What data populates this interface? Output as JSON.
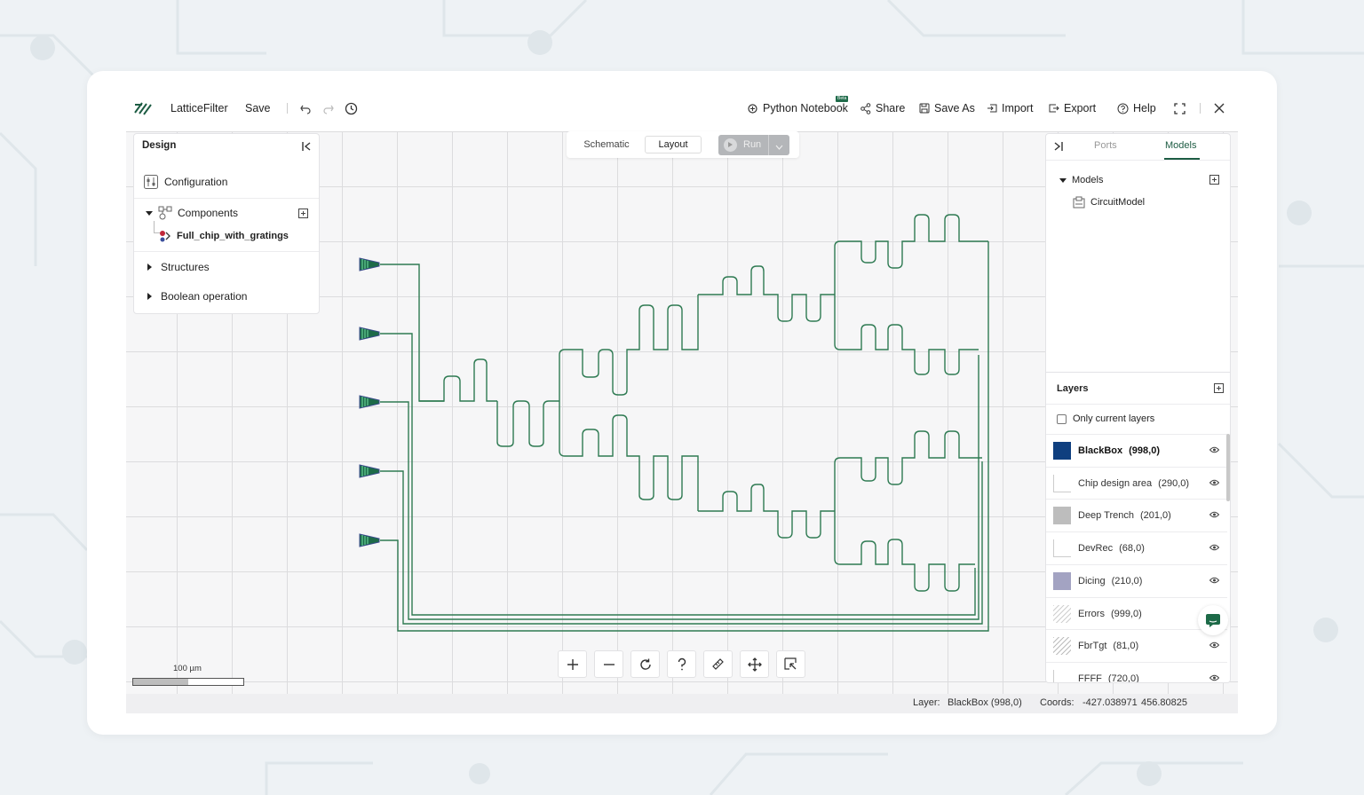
{
  "app": {
    "title": "LatticeFilter",
    "save_label": "Save"
  },
  "topbar": {
    "python_notebook": "Python Notebook",
    "beta_badge": "Beta",
    "share": "Share",
    "save_as": "Save As",
    "import": "Import",
    "export": "Export",
    "help": "Help"
  },
  "design_panel": {
    "title": "Design",
    "configuration": "Configuration",
    "components": "Components",
    "component_item": "Full_chip_with_gratings",
    "structures": "Structures",
    "boolean_operation": "Boolean operation"
  },
  "mode": {
    "schematic": "Schematic",
    "layout": "Layout",
    "active": "Layout",
    "run": "Run"
  },
  "right_panel": {
    "tabs": [
      "Ports",
      "Models"
    ],
    "active_tab": "Models",
    "models_header": "Models",
    "model_item": "CircuitModel",
    "layers_title": "Layers",
    "only_current_layers": "Only current layers",
    "layers": [
      {
        "name": "BlackBox",
        "code": "(998,0)",
        "color": "#0f3f7f",
        "fill": "solid",
        "bold": true
      },
      {
        "name": "Chip design area",
        "code": "(290,0)",
        "color": "#ffffff",
        "fill": "outline"
      },
      {
        "name": "Deep Trench",
        "code": "(201,0)",
        "color": "#bdbdbd",
        "fill": "solid"
      },
      {
        "name": "DevRec",
        "code": "(68,0)",
        "color": "#ffffff",
        "fill": "outline"
      },
      {
        "name": "Dicing",
        "code": "(210,0)",
        "color": "#a3a3c2",
        "fill": "solid"
      },
      {
        "name": "Errors",
        "code": "(999,0)",
        "color": "#cfcfcf",
        "fill": "hatch"
      },
      {
        "name": "FbrTgt",
        "code": "(81,0)",
        "color": "#bcbcbc",
        "fill": "hatch"
      },
      {
        "name": "FFFF",
        "code": "(720,0)",
        "color": "#ffffff",
        "fill": "outline"
      }
    ]
  },
  "scale": {
    "label": "100 µm"
  },
  "statusbar": {
    "layer_label": "Layer:",
    "layer_value": "BlackBox (998,0)",
    "coords_label": "Coords:",
    "coord_x": "-427.038971",
    "coord_y": "456.80825"
  },
  "icons": [
    "logo-icon",
    "undo-icon",
    "redo-icon",
    "history-icon",
    "notebook-icon",
    "share-icon",
    "save-icon",
    "import-icon",
    "export-icon",
    "help-icon",
    "fullscreen-icon",
    "close-icon",
    "zoom-in-icon",
    "zoom-out-icon",
    "refresh-icon",
    "question-icon",
    "ruler-icon",
    "move-icon",
    "select-icon",
    "chat-icon"
  ]
}
